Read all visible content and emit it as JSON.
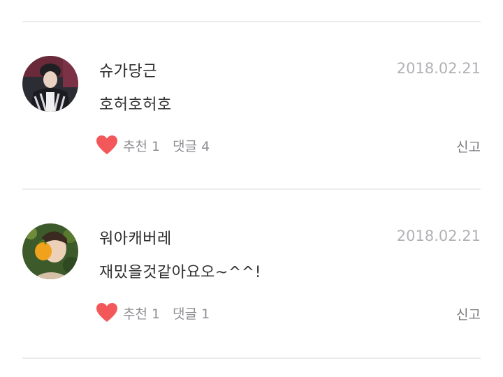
{
  "comments": [
    {
      "author": "슈가당근",
      "date": "2018.02.21",
      "text": "호허호허호",
      "recommend": "추천 1",
      "reply": "댓글 4",
      "report": "신고"
    },
    {
      "author": "워아캐버레",
      "date": "2018.02.21",
      "text": "재밌을것같아요오~^^!",
      "recommend": "추천 1",
      "reply": "댓글 1",
      "report": "신고"
    }
  ],
  "colors": {
    "heart": "#f2585a",
    "divider": "#ececec",
    "date": "#b2b2b6",
    "meta": "#8f8f94"
  },
  "icons": {
    "like": "heart-icon"
  }
}
